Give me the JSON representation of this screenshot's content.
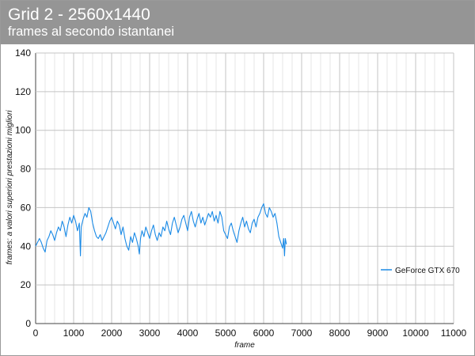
{
  "header": {
    "title": "Grid 2 - 2560x1440",
    "subtitle": "frames al secondo istantanei"
  },
  "chart_data": {
    "type": "line",
    "title": "Grid 2 - 2560x1440",
    "subtitle": "frames al secondo istantanei",
    "xlabel": "frame",
    "ylabel": "frames: a valori superiori prestazioni migliori",
    "xlim": [
      0,
      11000
    ],
    "ylim": [
      0,
      140
    ],
    "xticks": [
      0,
      1000,
      2000,
      3000,
      4000,
      5000,
      6000,
      7000,
      8000,
      9000,
      10000,
      11000
    ],
    "yticks": [
      0,
      20,
      40,
      60,
      80,
      100,
      120,
      140
    ],
    "grid": true,
    "legend_position": "right",
    "series": [
      {
        "name": "GeForce GTX 670",
        "color": "#1a8ae6",
        "points": [
          [
            0,
            40
          ],
          [
            50,
            42
          ],
          [
            100,
            44
          ],
          [
            150,
            42
          ],
          [
            200,
            39
          ],
          [
            250,
            37
          ],
          [
            300,
            43
          ],
          [
            350,
            45
          ],
          [
            400,
            48
          ],
          [
            450,
            46
          ],
          [
            500,
            43
          ],
          [
            550,
            47
          ],
          [
            600,
            50
          ],
          [
            650,
            48
          ],
          [
            700,
            53
          ],
          [
            750,
            50
          ],
          [
            800,
            45
          ],
          [
            850,
            51
          ],
          [
            900,
            55
          ],
          [
            950,
            52
          ],
          [
            1000,
            56
          ],
          [
            1050,
            53
          ],
          [
            1100,
            48
          ],
          [
            1150,
            52
          ],
          [
            1180,
            35
          ],
          [
            1200,
            50
          ],
          [
            1250,
            54
          ],
          [
            1300,
            57
          ],
          [
            1350,
            55
          ],
          [
            1400,
            60
          ],
          [
            1450,
            58
          ],
          [
            1500,
            52
          ],
          [
            1550,
            48
          ],
          [
            1600,
            45
          ],
          [
            1650,
            44
          ],
          [
            1700,
            46
          ],
          [
            1750,
            43
          ],
          [
            1800,
            45
          ],
          [
            1850,
            47
          ],
          [
            1900,
            50
          ],
          [
            1950,
            53
          ],
          [
            2000,
            55
          ],
          [
            2050,
            52
          ],
          [
            2100,
            49
          ],
          [
            2150,
            53
          ],
          [
            2200,
            51
          ],
          [
            2250,
            46
          ],
          [
            2300,
            50
          ],
          [
            2350,
            44
          ],
          [
            2400,
            40
          ],
          [
            2450,
            38
          ],
          [
            2500,
            45
          ],
          [
            2550,
            42
          ],
          [
            2600,
            47
          ],
          [
            2650,
            44
          ],
          [
            2700,
            40
          ],
          [
            2730,
            36
          ],
          [
            2760,
            44
          ],
          [
            2800,
            48
          ],
          [
            2850,
            45
          ],
          [
            2900,
            50
          ],
          [
            2950,
            47
          ],
          [
            3000,
            44
          ],
          [
            3050,
            48
          ],
          [
            3100,
            51
          ],
          [
            3150,
            46
          ],
          [
            3200,
            43
          ],
          [
            3250,
            47
          ],
          [
            3300,
            45
          ],
          [
            3350,
            50
          ],
          [
            3400,
            48
          ],
          [
            3450,
            53
          ],
          [
            3500,
            49
          ],
          [
            3550,
            46
          ],
          [
            3600,
            52
          ],
          [
            3650,
            55
          ],
          [
            3700,
            51
          ],
          [
            3750,
            47
          ],
          [
            3800,
            50
          ],
          [
            3850,
            54
          ],
          [
            3900,
            56
          ],
          [
            3950,
            52
          ],
          [
            4000,
            48
          ],
          [
            4050,
            55
          ],
          [
            4100,
            58
          ],
          [
            4150,
            53
          ],
          [
            4200,
            50
          ],
          [
            4250,
            54
          ],
          [
            4300,
            57
          ],
          [
            4350,
            52
          ],
          [
            4400,
            55
          ],
          [
            4450,
            51
          ],
          [
            4500,
            54
          ],
          [
            4550,
            57
          ],
          [
            4600,
            55
          ],
          [
            4650,
            58
          ],
          [
            4700,
            53
          ],
          [
            4750,
            56
          ],
          [
            4800,
            52
          ],
          [
            4850,
            58
          ],
          [
            4900,
            55
          ],
          [
            4950,
            48
          ],
          [
            5000,
            46
          ],
          [
            5050,
            44
          ],
          [
            5100,
            50
          ],
          [
            5150,
            52
          ],
          [
            5200,
            48
          ],
          [
            5250,
            45
          ],
          [
            5300,
            42
          ],
          [
            5350,
            48
          ],
          [
            5400,
            52
          ],
          [
            5450,
            55
          ],
          [
            5500,
            50
          ],
          [
            5550,
            53
          ],
          [
            5600,
            49
          ],
          [
            5650,
            47
          ],
          [
            5700,
            52
          ],
          [
            5750,
            54
          ],
          [
            5800,
            50
          ],
          [
            5850,
            55
          ],
          [
            5900,
            57
          ],
          [
            5950,
            60
          ],
          [
            6000,
            62
          ],
          [
            6050,
            57
          ],
          [
            6100,
            55
          ],
          [
            6150,
            60
          ],
          [
            6200,
            58
          ],
          [
            6250,
            55
          ],
          [
            6300,
            57
          ],
          [
            6350,
            52
          ],
          [
            6400,
            45
          ],
          [
            6450,
            42
          ],
          [
            6500,
            39
          ],
          [
            6530,
            44
          ],
          [
            6550,
            35
          ],
          [
            6570,
            44
          ],
          [
            6600,
            41
          ]
        ]
      }
    ]
  }
}
